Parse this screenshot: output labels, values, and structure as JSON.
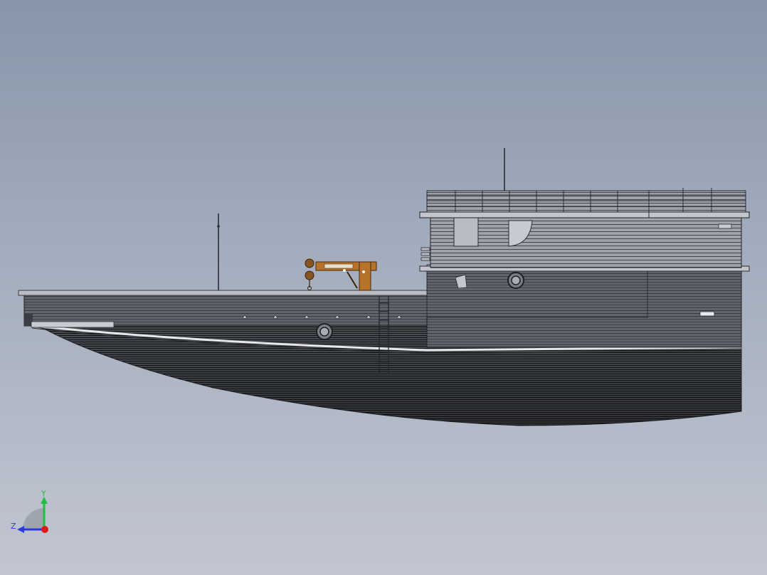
{
  "viewport": {
    "background_top": "#8896aa",
    "background_bottom": "#c2c6d1"
  },
  "model": {
    "hull_color": "#5c5f66",
    "hull_line_color": "#1c1e22",
    "deck_color": "#b9bcc3",
    "crane_color": "#b8732a",
    "highlight_color": "#e6e8ec"
  },
  "triad": {
    "y_label": "Y",
    "z_label": "Z",
    "y_color": "#18c23a",
    "z_color": "#2a3cd8",
    "x_color": "#e01818"
  }
}
